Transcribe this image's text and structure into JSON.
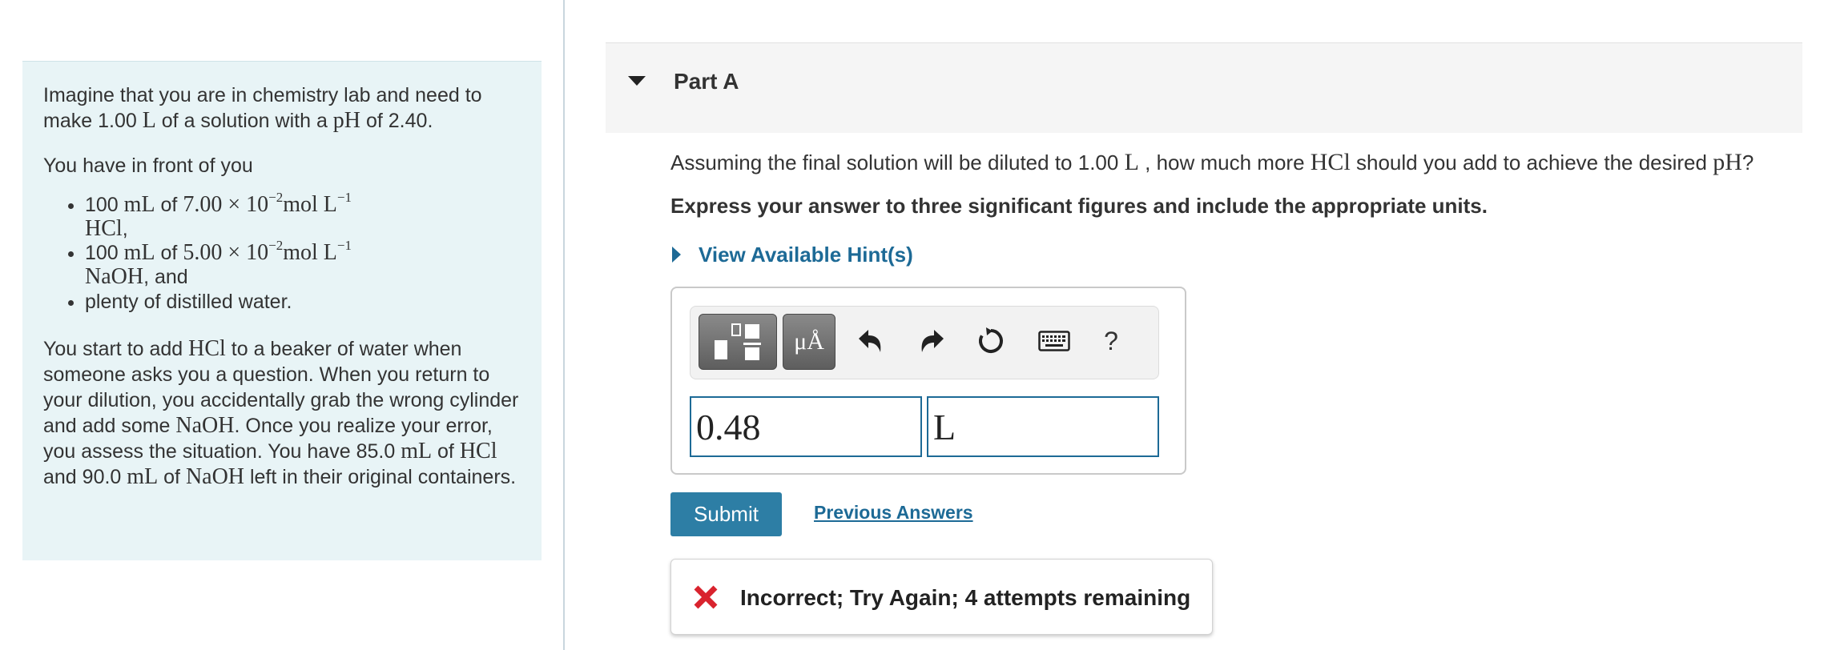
{
  "problem": {
    "intro_1": "Imagine that you are in chemistry lab and need to make ",
    "intro_volume": "1.00",
    "intro_L": "L",
    "intro_2": " of a solution with a ",
    "intro_pH": "pH",
    "intro_3": " of ",
    "intro_pH_value": "2.40",
    "intro_4": ".",
    "you_have": "You have in front of you",
    "item1": {
      "amount": "100",
      "unit": "mL",
      "of": " of ",
      "value": "7.00 × 10",
      "exponent": "−2",
      "mol": "mol L",
      "mol_exp": "−1",
      "compound": "HCl",
      "trail": ","
    },
    "item2": {
      "amount": "100",
      "unit": "mL",
      "of": " of ",
      "value": "5.00 × 10",
      "exponent": "−2",
      "mol": "mol L",
      "mol_exp": "−1",
      "compound": "NaOH",
      "trail": ", and"
    },
    "item3": "plenty of distilled water.",
    "para_a": "You start to add ",
    "para_hcl": "HCl",
    "para_b": " to a beaker of water when someone asks you a question. When you return to your dilution, you accidentally grab the wrong cylinder and add some ",
    "para_naoh": "NaOH",
    "para_c": ". Once you realize your error, you assess the situation. You have ",
    "para_v1": "85.0",
    "para_ml1": "mL",
    "para_d": " of ",
    "para_hcl2": "HCl",
    "para_e": " and ",
    "para_v2": "90.0",
    "para_ml2": "mL",
    "para_f": " of ",
    "para_naoh2": "NaOH",
    "para_g": " left in their original containers."
  },
  "part": {
    "title": "Part A"
  },
  "question": {
    "q1": "Assuming the final solution will be diluted to ",
    "q_volume": "1.00",
    "q_L": "L",
    "q2": " , how much more ",
    "q_hcl": "HCl",
    "q3": " should you add to achieve the desired ",
    "q_pH": "pH",
    "q4": "?",
    "instruction": "Express your answer to three significant figures and include the appropriate units."
  },
  "hints": {
    "label": "View Available Hint(s)"
  },
  "toolbar": {
    "units_label": "μÅ",
    "help_label": "?"
  },
  "answer": {
    "value": "0.48",
    "units": "L"
  },
  "actions": {
    "submit_label": "Submit",
    "previous_label": "Previous Answers"
  },
  "feedback": {
    "message": "Incorrect; Try Again; 4 attempts remaining"
  },
  "colors": {
    "accent": "#1d6a96",
    "submit_bg": "#2d7ea5",
    "panel_bg": "#e8f4f6",
    "error": "#d9232e"
  }
}
